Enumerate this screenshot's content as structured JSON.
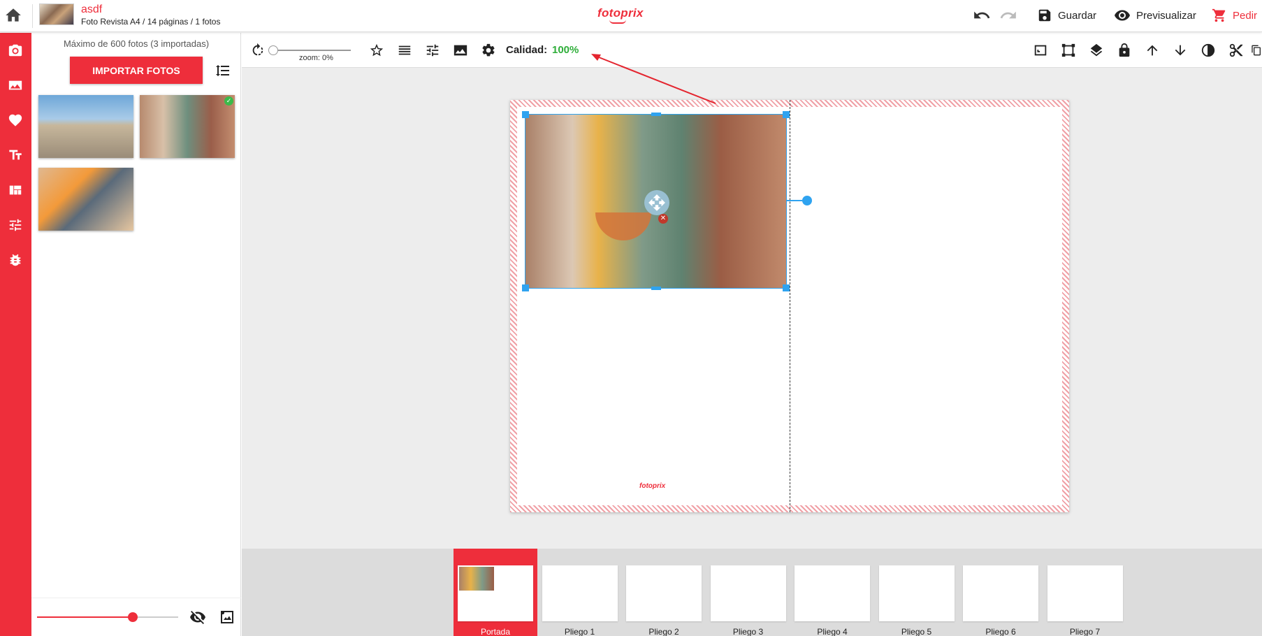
{
  "header": {
    "project_name": "asdf",
    "project_meta": "Foto Revista A4 / 14 páginas / 1 fotos",
    "logo": "fotoprix",
    "save_label": "Guardar",
    "preview_label": "Previsualizar",
    "order_label": "Pedir",
    "icons": [
      "home-icon",
      "undo-icon",
      "redo-icon",
      "save-icon",
      "eye-icon",
      "cart-icon"
    ]
  },
  "rail": {
    "items": [
      {
        "name": "photos",
        "icon": "camera-icon"
      },
      {
        "name": "backgrounds",
        "icon": "image-icon"
      },
      {
        "name": "cliparts",
        "icon": "heart-icon"
      },
      {
        "name": "text",
        "icon": "text-icon"
      },
      {
        "name": "layouts",
        "icon": "layout-icon"
      },
      {
        "name": "adjustments",
        "icon": "sliders-icon"
      },
      {
        "name": "bug-report",
        "icon": "bug-icon"
      }
    ]
  },
  "photos_panel": {
    "max_note": "Máximo de 600 fotos (3 importadas)",
    "import_label": "IMPORTAR FOTOS",
    "photos": [
      {
        "subject": "plaza-with-tower",
        "used": false
      },
      {
        "subject": "venice-canal",
        "used": true
      },
      {
        "subject": "photo-books-on-table",
        "used": false
      }
    ],
    "thumb_size_level": 0.68
  },
  "toolbar": {
    "zoom_label": "zoom: 0%",
    "zoom_level": 0,
    "quality_label": "Calidad:",
    "quality_value": "100%",
    "colors": {
      "quality_ok": "#2fae3a",
      "accent": "#ee2e3b",
      "selection": "#2fa3f0"
    }
  },
  "canvas": {
    "page_logo": "fotoprix"
  },
  "pages": [
    {
      "label": "Portada",
      "active": true
    },
    {
      "label": "Pliego 1",
      "active": false
    },
    {
      "label": "Pliego 2",
      "active": false
    },
    {
      "label": "Pliego 3",
      "active": false
    },
    {
      "label": "Pliego 4",
      "active": false
    },
    {
      "label": "Pliego 5",
      "active": false
    },
    {
      "label": "Pliego 6",
      "active": false
    },
    {
      "label": "Pliego 7",
      "active": false
    }
  ]
}
